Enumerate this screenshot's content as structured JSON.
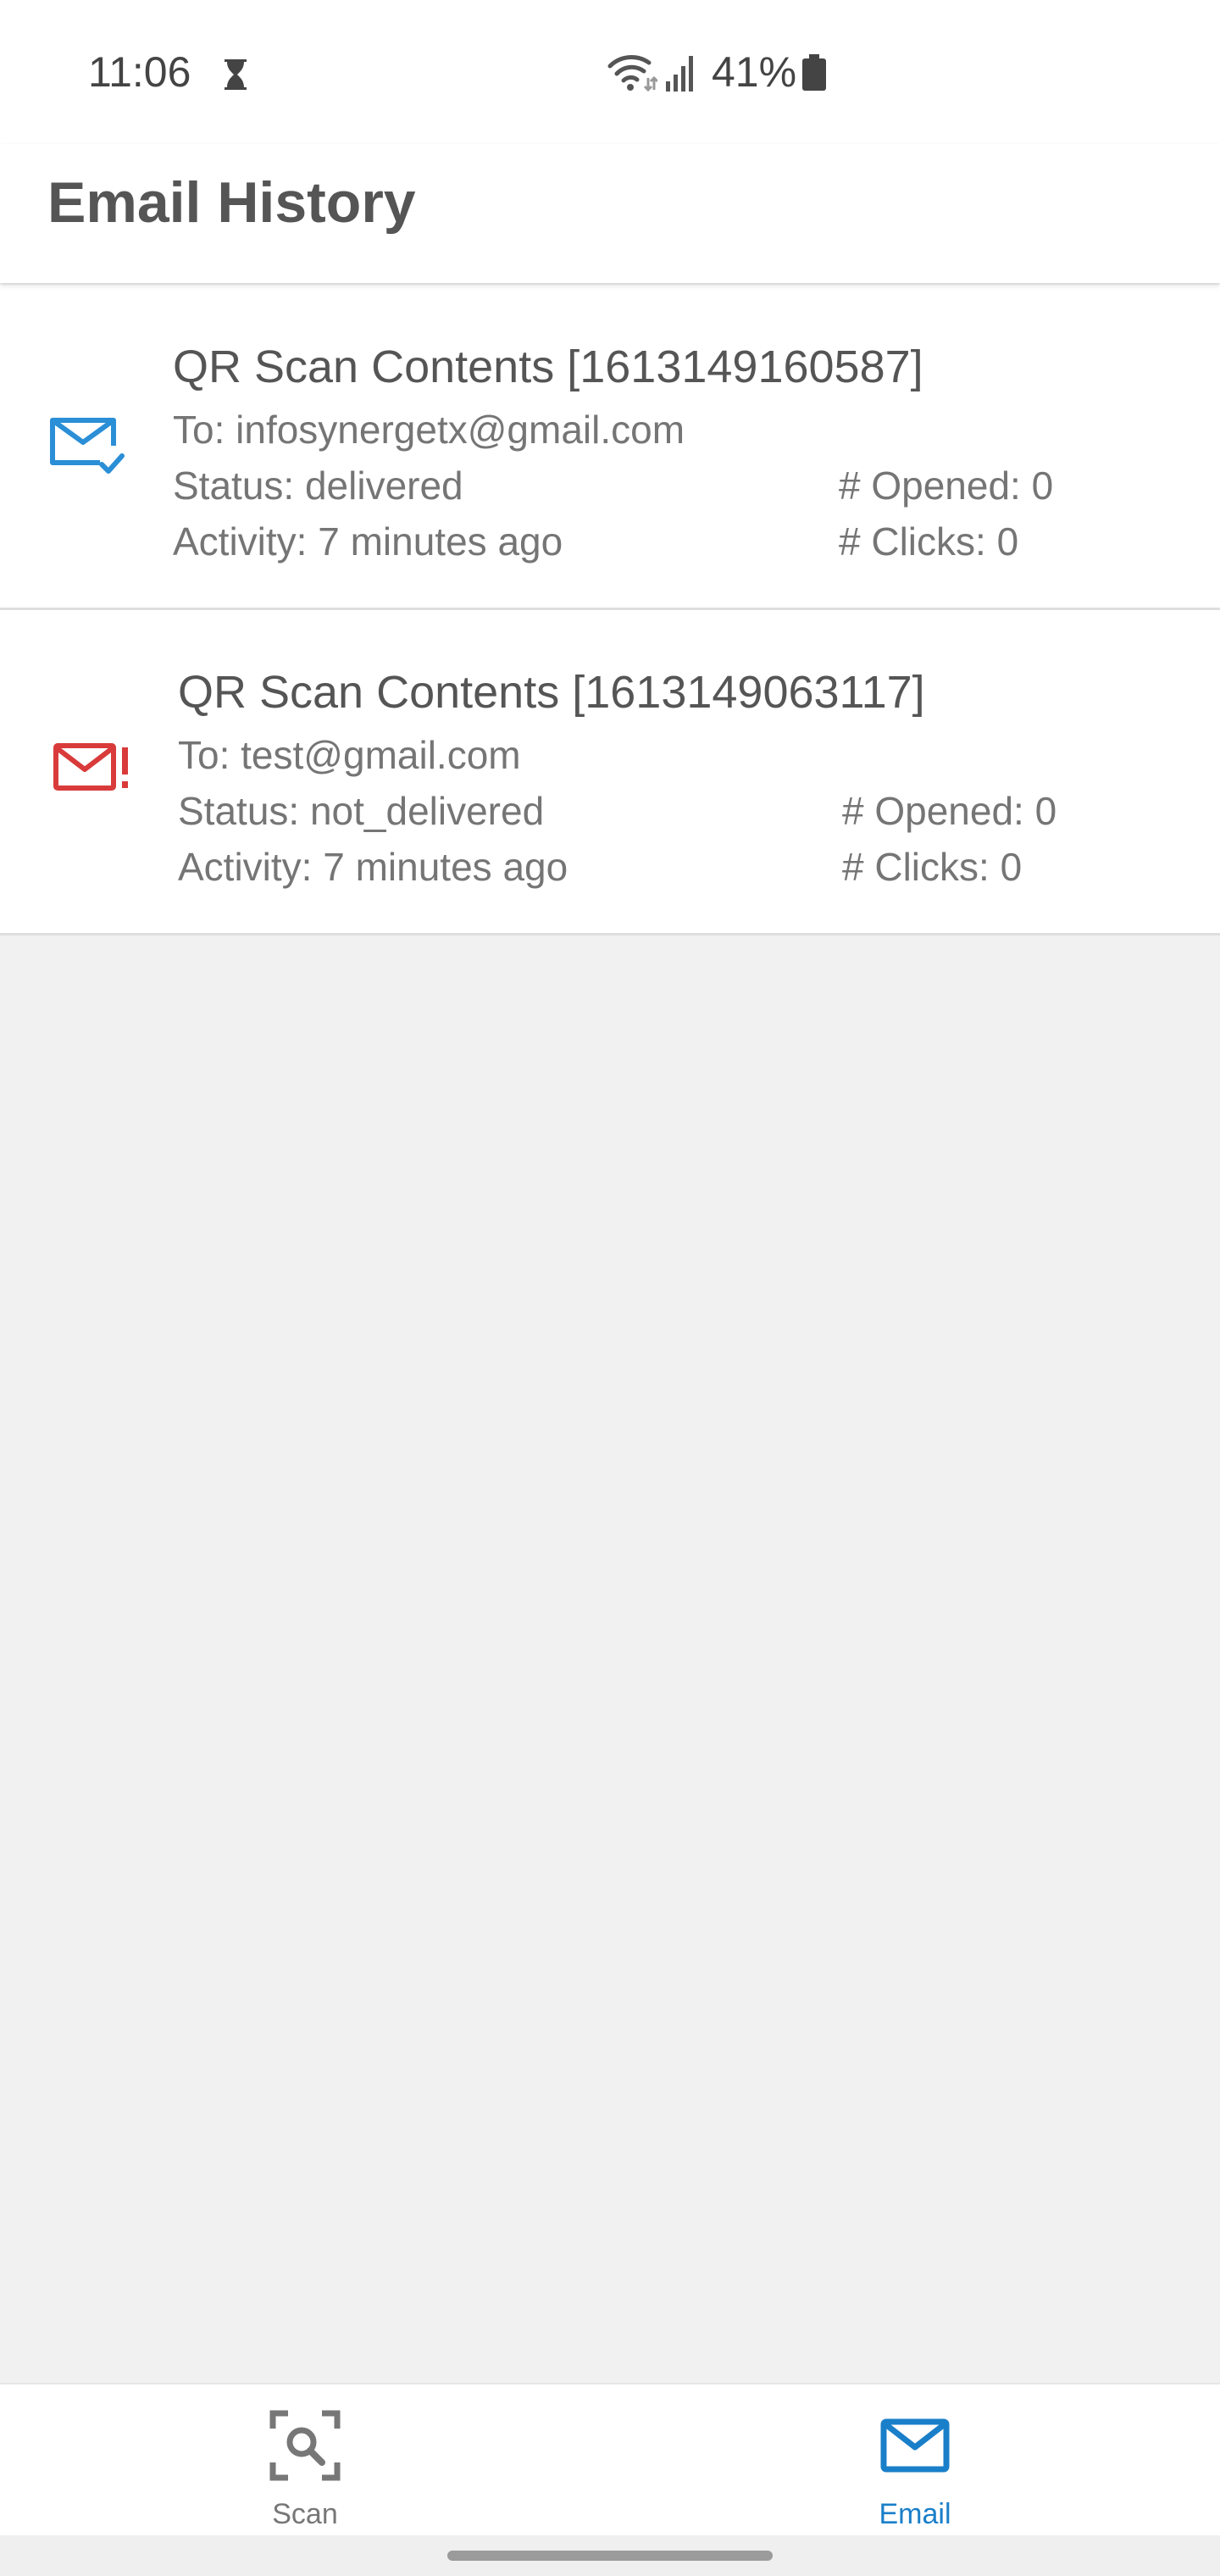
{
  "status_bar": {
    "time": "11:06",
    "battery_percent": "41%"
  },
  "app_bar": {
    "title": "Email History"
  },
  "emails": [
    {
      "subject": "QR Scan Contents [1613149160587]",
      "to": "To: infosynergetx@gmail.com",
      "status": "Status: delivered",
      "activity": "Activity: 7 minutes ago",
      "opened": "# Opened: 0",
      "clicks": "# Clicks: 0",
      "icon": "mail-check-icon",
      "icon_color": "#2a8fd6"
    },
    {
      "subject": "QR Scan Contents [1613149063117]",
      "to": "To: test@gmail.com",
      "status": "Status: not_delivered",
      "activity": "Activity: 7 minutes ago",
      "opened": "# Opened: 0",
      "clicks": "# Clicks: 0",
      "icon": "mail-alert-icon",
      "icon_color": "#d93a3a"
    }
  ],
  "bottom_nav": {
    "items": [
      {
        "label": "Scan",
        "icon": "qr-scan-icon",
        "active": false
      },
      {
        "label": "Email",
        "icon": "mail-icon",
        "active": true
      }
    ],
    "active_color": "#1a7fc9",
    "inactive_color": "#777777"
  }
}
